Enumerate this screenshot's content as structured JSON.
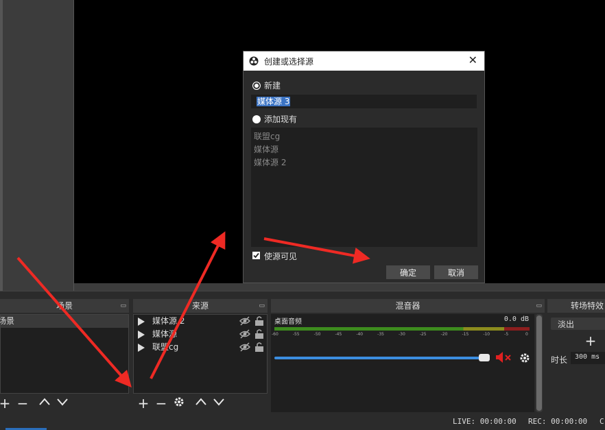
{
  "panels": {
    "scenes": {
      "title": "场景",
      "items": [
        "场景"
      ]
    },
    "sources": {
      "title": "来源",
      "items": [
        {
          "name": "媒体源 2"
        },
        {
          "name": "媒体源"
        },
        {
          "name": "联盟cg"
        }
      ]
    },
    "mixer": {
      "title": "混音器",
      "track_name": "桌面音频",
      "db_value": "0.0 dB",
      "ticks": [
        "-60",
        "-55",
        "-50",
        "-45",
        "-40",
        "-35",
        "-30",
        "-25",
        "-20",
        "-15",
        "-10",
        "-5",
        "0"
      ],
      "volume_level": 1.0,
      "muted": true
    },
    "transitions": {
      "title": "转场特效",
      "selected": "淡出",
      "duration_label": "时长",
      "duration_value": "300 ms"
    }
  },
  "status": {
    "live": "LIVE: 00:00:00",
    "rec": "REC: 00:00:00",
    "cpu": "C"
  },
  "dialog": {
    "title": "创建或选择源",
    "create_new_label": "新建",
    "new_name_value": "媒体源 3",
    "add_existing_label": "添加现有",
    "existing_sources": [
      "联盟cg",
      "媒体源",
      "媒体源 2"
    ],
    "make_visible_label": "使源可见",
    "make_visible_checked": true,
    "ok_label": "确定",
    "cancel_label": "取消",
    "selected_option": "create_new"
  },
  "colors": {
    "accent": "#3c74c4",
    "volume": "#3c8ee0",
    "mute": "#e02020",
    "arrow": "#ee2a24"
  }
}
